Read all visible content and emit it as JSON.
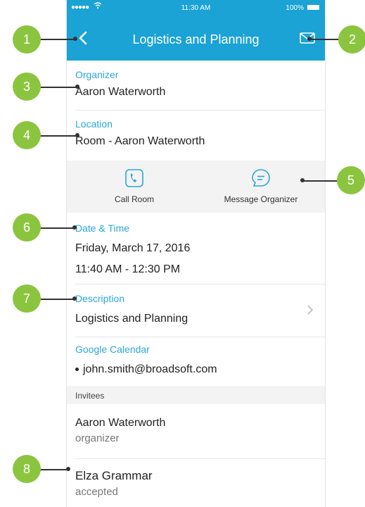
{
  "status_bar": {
    "signal": "●●●●●",
    "time": "11:30 AM",
    "battery": "100%"
  },
  "header": {
    "title": "Logistics and Planning"
  },
  "organizer": {
    "label": "Organizer",
    "value": "Aaron Waterworth"
  },
  "location": {
    "label": "Location",
    "value": "Room - Aaron Waterworth"
  },
  "actions": {
    "call_label": "Call Room",
    "message_label": "Message Organizer"
  },
  "datetime": {
    "label": "Date & Time",
    "date": "Friday, March 17, 2016",
    "time": "11:40 AM - 12:30 PM"
  },
  "description": {
    "label": "Description",
    "value": "Logistics and Planning"
  },
  "calendar": {
    "label": "Google Calendar",
    "account": "john.smith@broadsoft.com"
  },
  "invitees": {
    "header": "Invitees",
    "items": [
      {
        "name": "Aaron Waterworth",
        "status": "organizer"
      },
      {
        "name": "Elza Grammar",
        "status": "accepted"
      }
    ]
  },
  "callouts": [
    "1",
    "2",
    "3",
    "4",
    "5",
    "6",
    "7",
    "8"
  ],
  "colors": {
    "accent": "#1aa3d4",
    "label": "#2aa8d8",
    "callout": "#8bc53f"
  }
}
